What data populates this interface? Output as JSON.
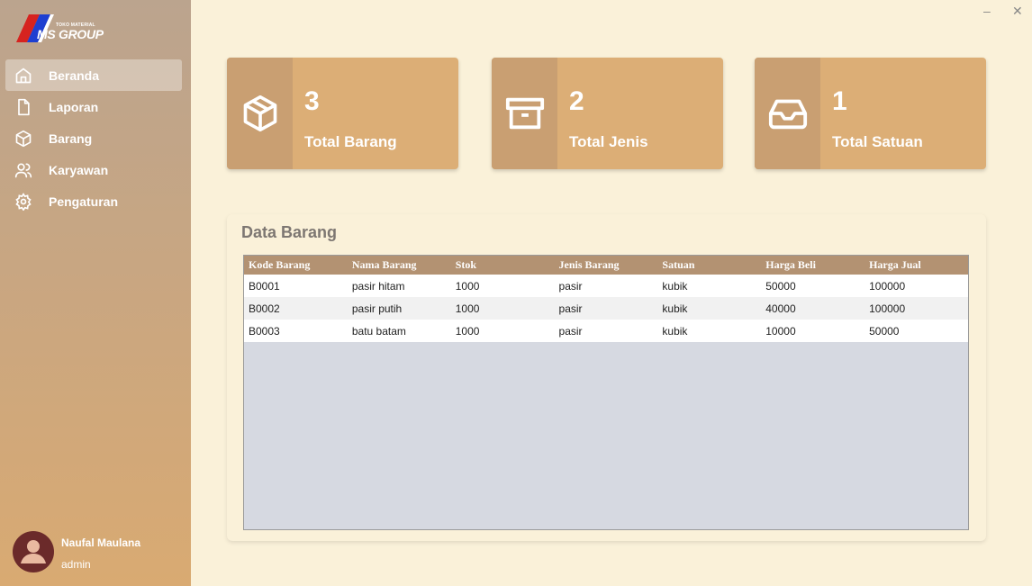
{
  "logo": {
    "small": "TOKO MATERIAL",
    "big": "MS GROUP"
  },
  "nav": [
    {
      "label": "Beranda",
      "icon": "home-icon",
      "active": true
    },
    {
      "label": "Laporan",
      "icon": "file-icon",
      "active": false
    },
    {
      "label": "Barang",
      "icon": "box-icon",
      "active": false
    },
    {
      "label": "Karyawan",
      "icon": "users-icon",
      "active": false
    },
    {
      "label": "Pengaturan",
      "icon": "gear-icon",
      "active": false
    }
  ],
  "user": {
    "name": "Naufal Maulana",
    "role": "admin"
  },
  "window": {
    "minimize": "–",
    "close": "✕"
  },
  "cards": [
    {
      "value": "3",
      "label": "Total Barang",
      "icon": "package-icon"
    },
    {
      "value": "2",
      "label": "Total Jenis",
      "icon": "archive-icon"
    },
    {
      "value": "1",
      "label": "Total Satuan",
      "icon": "inbox-icon"
    }
  ],
  "panel": {
    "title": "Data Barang",
    "columns": [
      "Kode Barang",
      "Nama Barang",
      "Stok",
      "Jenis Barang",
      "Satuan",
      "Harga Beli",
      "Harga Jual"
    ],
    "rows": [
      [
        "B0001",
        "pasir hitam",
        "1000",
        "pasir",
        "kubik",
        "50000",
        "100000"
      ],
      [
        "B0002",
        "pasir putih",
        "1000",
        "pasir",
        "kubik",
        "40000",
        "100000"
      ],
      [
        "B0003",
        "batu batam",
        "1000",
        "pasir",
        "kubik",
        "10000",
        "50000"
      ]
    ]
  },
  "colors": {
    "sidebar_top": "#bba48e",
    "sidebar_bottom": "#d9aa72",
    "card": "#dcae76",
    "card_icon": "#c99f72",
    "table_header": "#b39272",
    "background": "#faf1d9"
  }
}
